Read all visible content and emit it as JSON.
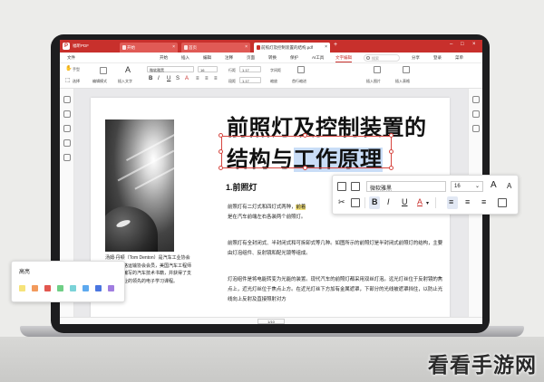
{
  "window": {
    "app_name": "福昕PDF",
    "tabs": [
      {
        "label": "开始"
      },
      {
        "label": "首页"
      },
      {
        "label": "前照灯及控制装置的结构.pdf"
      }
    ]
  },
  "menu": {
    "items": [
      "文件",
      "开始",
      "插入",
      "编辑",
      "注释",
      "页面",
      "转换",
      "保护",
      "AI工具",
      "文字编辑"
    ],
    "active": "文字编辑",
    "search_placeholder": "搜索",
    "right_items": [
      "分享",
      "登录",
      "菜单"
    ]
  },
  "toolbar": {
    "hand_label": "手型",
    "select_label": "选择",
    "edit_mode_label": "编辑模式",
    "insert_text_label": "插入文字",
    "font_family": "微软雅黑",
    "font_size": "16",
    "line_spacing": "1.17",
    "para_spacing": "1.17",
    "spacing_label": "字间距",
    "scale_label": "缩放",
    "indent_label": "首行缩进",
    "insert_image_label": "插入图片",
    "insert_table_label": "插入表格"
  },
  "document": {
    "title_line1": "前照灯及控制装置的",
    "title_line2_pre": "结构与",
    "title_line2_highlight": "工作原理",
    "section_title": "1.前照灯",
    "para1_a": "前照灯有二灯式和四灯式两种，",
    "para1_hl": "前着",
    "para1_b": "是在汽车前端左右各装两个前照灯。",
    "para2": "前照灯有全封闭式、半封闭式和可拆卸式等几种。如图所示的前照灯是半封闭式前照灯的结构，主要由灯泡组件、反射镜和配光镜等组成。",
    "para3": "灯泡组件是将电能转变为光能的装置。现代汽车的前照灯都采用双丝灯泡。远光灯丝位于反射镜的焦点上，近光灯丝位于焦点上方。在近光灯丝下方加有金属遮罩，下部分的光线被遮罩挡住，以防止光线向上反射及直接照射对方",
    "caption": "汤姆·丹顿（Tom Denton）是汽车工业协会会员、道路运输协会会员，美国汽车工程师协会、他编写的汽车技术书籍，并获得了支持汽车行业的领先的电子学习课程。"
  },
  "format_toolbar": {
    "font_family": "微软雅黑",
    "font_size": "16",
    "grow_label": "A",
    "shrink_label": "A",
    "bold": "B",
    "italic": "I",
    "underline": "U",
    "font_color": "A"
  },
  "highlight_popup": {
    "title": "高亮",
    "colors": [
      "#f6e37a",
      "#f29a5c",
      "#e2574f",
      "#6fcf86",
      "#7bd3d8",
      "#5da9ef",
      "#4a76e0",
      "#a07de0"
    ]
  },
  "statusbar": {
    "page_indicator": "1/10"
  },
  "watermark": "看看手游网"
}
